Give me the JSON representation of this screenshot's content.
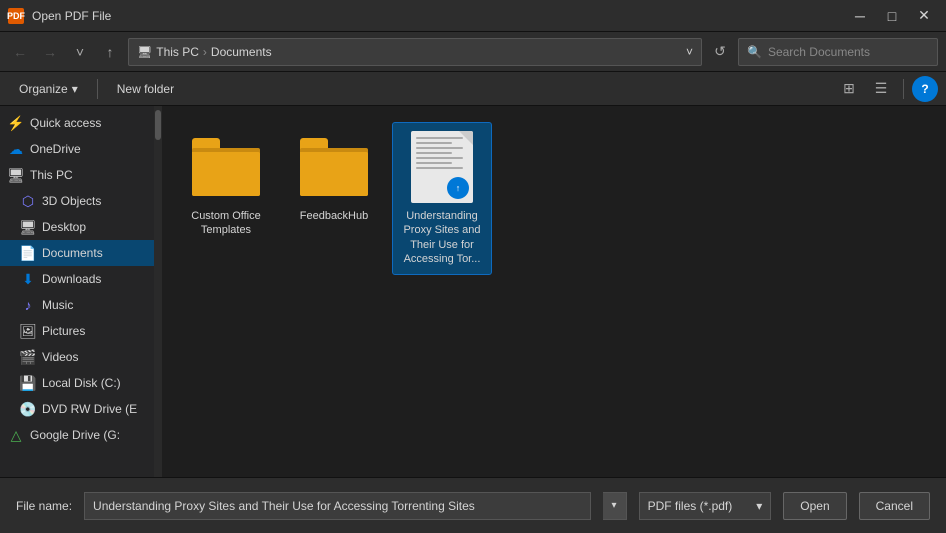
{
  "window": {
    "title": "Open PDF File",
    "icon_label": "PDF"
  },
  "titlebar": {
    "minimize_label": "─",
    "maximize_label": "□",
    "close_label": "✕"
  },
  "addressbar": {
    "back_label": "←",
    "forward_label": "→",
    "recent_label": "˅",
    "up_label": "↑",
    "path_root": "This PC",
    "path_sep": "›",
    "path_current": "Documents",
    "refresh_label": "↺",
    "search_placeholder": "Search Documents"
  },
  "toolbar": {
    "organize_label": "Organize",
    "organize_chevron": "▾",
    "new_folder_label": "New folder",
    "view_label1": "⊞",
    "view_label2": "☰",
    "help_label": "?"
  },
  "sidebar": {
    "items": [
      {
        "label": "Quick access",
        "icon": "⚡",
        "color": "#f0b429",
        "active": false
      },
      {
        "label": "OneDrive",
        "icon": "☁",
        "color": "#0078d7",
        "active": false
      },
      {
        "label": "This PC",
        "icon": "💻",
        "color": "#d4d4d4",
        "active": false
      },
      {
        "label": "3D Objects",
        "icon": "⬡",
        "color": "#7c7cff",
        "active": false
      },
      {
        "label": "Desktop",
        "icon": "🖥",
        "color": "#d4d4d4",
        "active": false
      },
      {
        "label": "Documents",
        "icon": "📄",
        "color": "#d4d4d4",
        "active": true
      },
      {
        "label": "Downloads",
        "icon": "⬇",
        "color": "#0078d7",
        "active": false
      },
      {
        "label": "Music",
        "icon": "♪",
        "color": "#7c7cff",
        "active": false
      },
      {
        "label": "Pictures",
        "icon": "🖼",
        "color": "#d4d4d4",
        "active": false
      },
      {
        "label": "Videos",
        "icon": "🎬",
        "color": "#d4d4d4",
        "active": false
      },
      {
        "label": "Local Disk (C:)",
        "icon": "💾",
        "color": "#d4d4d4",
        "active": false
      },
      {
        "label": "DVD RW Drive (E",
        "icon": "💿",
        "color": "#d4d4d4",
        "active": false
      },
      {
        "label": "Google Drive (G:",
        "icon": "△",
        "color": "#4caf50",
        "active": false
      }
    ]
  },
  "files": [
    {
      "type": "folder",
      "label": "Custom Office Templates",
      "selected": false
    },
    {
      "type": "folder",
      "label": "FeedbackHub",
      "selected": false
    },
    {
      "type": "pdf",
      "label": "Understanding Proxy Sites and Their Use for Accessing Tor...",
      "selected": true
    }
  ],
  "bottombar": {
    "filename_label": "File name:",
    "filename_value": "Understanding Proxy Sites and Their Use for Accessing Torrenting Sites",
    "filetype_value": "PDF files (*.pdf)",
    "open_label": "Open",
    "cancel_label": "Cancel"
  }
}
